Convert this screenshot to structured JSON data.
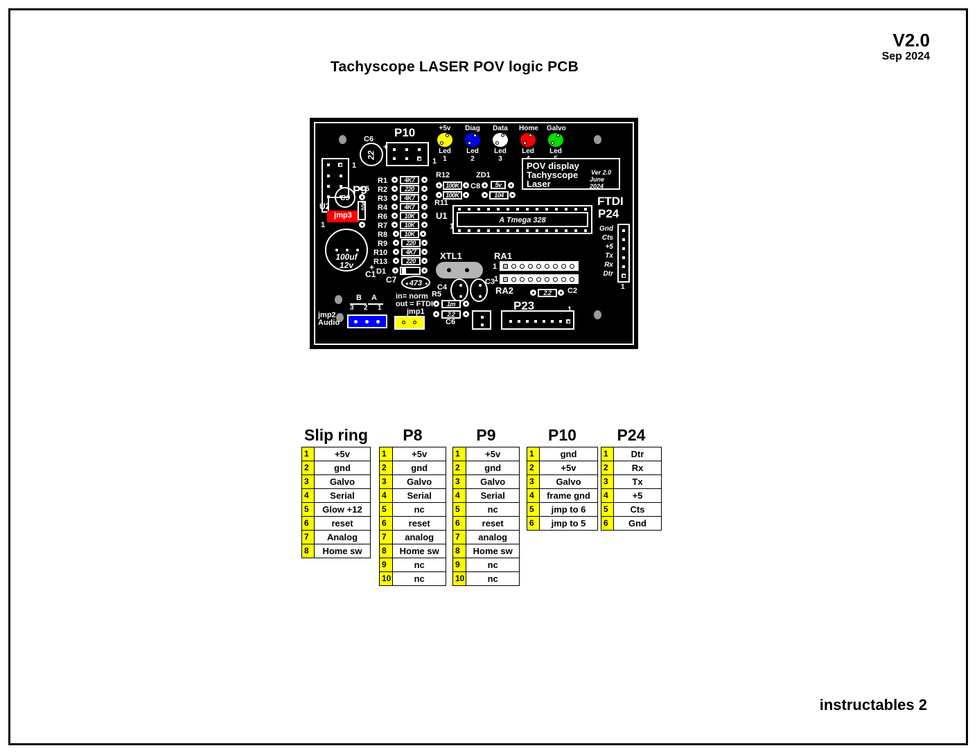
{
  "page": {
    "title": "Tachyscope LASER POV logic PCB",
    "version": "V2.0",
    "version_date": "Sep 2024",
    "footer": "instructables 2"
  },
  "pcb": {
    "silk_label": {
      "line1": "POV display",
      "line2": "Tachyscope",
      "line3": "Laser",
      "ver": "Ver 2.0",
      "date": "June 2024"
    },
    "leds": [
      {
        "name": "+5v",
        "ref": "Led 1",
        "color": "#ffff00"
      },
      {
        "name": "Diag",
        "ref": "Led 2",
        "color": "#0000ee"
      },
      {
        "name": "Data",
        "ref": "Led 3",
        "color": "#ffffff"
      },
      {
        "name": "Home",
        "ref": "Led 4",
        "color": "#ff0000"
      },
      {
        "name": "Galvo",
        "ref": "Led 5",
        "color": "#00dd00"
      }
    ],
    "connectors": {
      "p10": "P10",
      "p9": "P9",
      "p23": "P23",
      "p24": "P24",
      "ftdi": "FTDI"
    },
    "ftdi_pins": [
      "Gnd",
      "Cts",
      "+5",
      "Tx",
      "Rx",
      "Dtr"
    ],
    "ftdi_pin1": "1",
    "resistors": [
      {
        "ref": "R1",
        "value": "4K7"
      },
      {
        "ref": "R2",
        "value": "220"
      },
      {
        "ref": "R3",
        "value": "4K7"
      },
      {
        "ref": "R4",
        "value": "4K7"
      },
      {
        "ref": "R6",
        "value": "10K"
      },
      {
        "ref": "R7",
        "value": "10K"
      },
      {
        "ref": "R8",
        "value": "10K"
      },
      {
        "ref": "R9",
        "value": "220"
      },
      {
        "ref": "R10",
        "value": "4K7"
      },
      {
        "ref": "R13",
        "value": "220"
      }
    ],
    "diode": {
      "ref": "D1"
    },
    "r12": {
      "ref": "R12",
      "value": "100K"
    },
    "r11": {
      "ref": "R11",
      "value": "100K"
    },
    "zd1": {
      "ref": "ZD1",
      "value": "5v"
    },
    "c8": {
      "ref": "C8",
      "value": "104"
    },
    "c5": {
      "ref": "C5",
      "value": "104"
    },
    "c7": {
      "ref": "C7",
      "value": "473"
    },
    "c6_top": {
      "ref": "C6",
      "value": "22",
      "plus": "+"
    },
    "c1": {
      "ref": "C1",
      "value1": "100uf",
      "value2": "12v",
      "plus": "+"
    },
    "c9": {
      "ref": "C9"
    },
    "c4": {
      "ref": "C4"
    },
    "c3": {
      "ref": "C3"
    },
    "c2": {
      "ref": "C2",
      "value": "2.2"
    },
    "r5": {
      "ref": "R5",
      "value": "1m"
    },
    "c6_bot": {
      "ref": "C6",
      "value": "2.2"
    },
    "u1": {
      "ref": "U1",
      "chip": "A Tmega 328",
      "pin1": "1"
    },
    "u2": {
      "ref": "U2",
      "pin1": "1"
    },
    "xtl1": "XTL1",
    "ra1": "RA1",
    "ra2": "RA2",
    "ra_pin1": "1",
    "jmp3": "jmp3",
    "jmp2": {
      "label1": "jmp2",
      "label2": "Audio",
      "a": "A",
      "b": "B",
      "n1": "1",
      "n2": "2",
      "n3": "3"
    },
    "jmp1": {
      "label": "jmp1",
      "note1": "in= norm",
      "note2": "out = FTDI"
    },
    "pin_ones": "1"
  },
  "tables": [
    {
      "title": "Slip ring",
      "rows": [
        {
          "n": "1",
          "v": "+5v"
        },
        {
          "n": "2",
          "v": "gnd"
        },
        {
          "n": "3",
          "v": "Galvo"
        },
        {
          "n": "4",
          "v": "Serial"
        },
        {
          "n": "5",
          "v": "Glow +12"
        },
        {
          "n": "6",
          "v": "reset"
        },
        {
          "n": "7",
          "v": "Analog"
        },
        {
          "n": "8",
          "v": "Home sw"
        }
      ]
    },
    {
      "title": "P8",
      "rows": [
        {
          "n": "1",
          "v": "+5v"
        },
        {
          "n": "2",
          "v": "gnd"
        },
        {
          "n": "3",
          "v": "Galvo"
        },
        {
          "n": "4",
          "v": "Serial"
        },
        {
          "n": "5",
          "v": "nc"
        },
        {
          "n": "6",
          "v": "reset"
        },
        {
          "n": "7",
          "v": "analog"
        },
        {
          "n": "8",
          "v": "Home sw"
        },
        {
          "n": "9",
          "v": "nc"
        },
        {
          "n": "10",
          "v": "nc"
        }
      ]
    },
    {
      "title": "P9",
      "rows": [
        {
          "n": "1",
          "v": "+5v"
        },
        {
          "n": "2",
          "v": "gnd"
        },
        {
          "n": "3",
          "v": "Galvo"
        },
        {
          "n": "4",
          "v": "Serial"
        },
        {
          "n": "5",
          "v": "nc"
        },
        {
          "n": "6",
          "v": "reset"
        },
        {
          "n": "7",
          "v": "analog"
        },
        {
          "n": "8",
          "v": "Home sw"
        },
        {
          "n": "9",
          "v": "nc"
        },
        {
          "n": "10",
          "v": "nc"
        }
      ]
    },
    {
      "title": "P10",
      "rows": [
        {
          "n": "1",
          "v": "gnd"
        },
        {
          "n": "2",
          "v": "+5v"
        },
        {
          "n": "3",
          "v": "Galvo"
        },
        {
          "n": "4",
          "v": "frame gnd"
        },
        {
          "n": "5",
          "v": "jmp to 6"
        },
        {
          "n": "6",
          "v": "jmp to 5"
        }
      ]
    },
    {
      "title": "P24",
      "rows": [
        {
          "n": "1",
          "v": "Dtr"
        },
        {
          "n": "2",
          "v": "Rx"
        },
        {
          "n": "3",
          "v": "Tx"
        },
        {
          "n": "4",
          "v": "+5"
        },
        {
          "n": "5",
          "v": "Cts"
        },
        {
          "n": "6",
          "v": "Gnd"
        }
      ]
    }
  ]
}
